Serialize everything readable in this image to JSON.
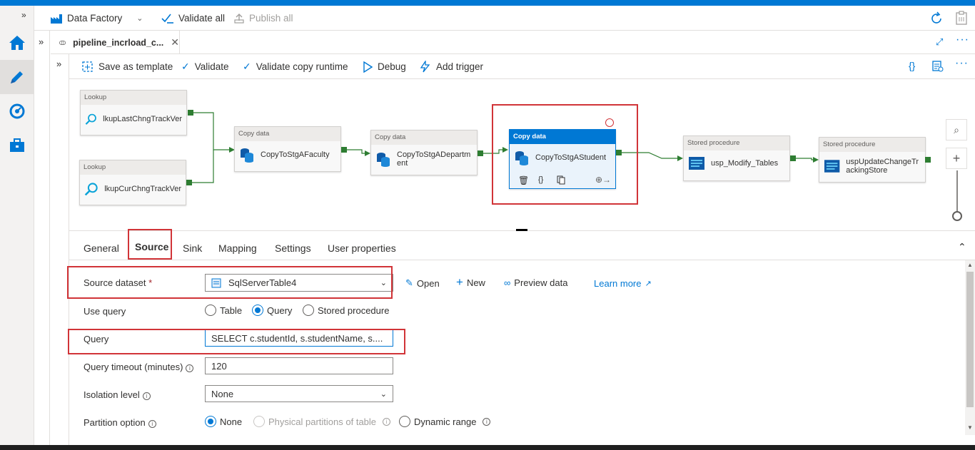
{
  "factory_bar": {
    "factory_name": "Data Factory",
    "validate_all": "Validate all",
    "publish_all": "Publish all"
  },
  "doc_tab": {
    "title": "pipeline_incrload_c..."
  },
  "command_bar": {
    "save_as_template": "Save as template",
    "validate": "Validate",
    "validate_copy_runtime": "Validate copy runtime",
    "debug": "Debug",
    "add_trigger": "Add trigger"
  },
  "activities": [
    {
      "type": "Lookup",
      "name": "lkupLastChngTrackVer"
    },
    {
      "type": "Lookup",
      "name": "lkupCurChngTrackVer"
    },
    {
      "type": "Copy data",
      "name": "CopyToStgAFaculty"
    },
    {
      "type": "Copy data",
      "name": "CopyToStgADepartment"
    },
    {
      "type": "Copy data",
      "name": "CopyToStgAStudent"
    },
    {
      "type": "Stored procedure",
      "name": "usp_Modify_Tables"
    },
    {
      "type": "Stored procedure",
      "name": "uspUpdateChangeTrackingStore"
    }
  ],
  "panel_tabs": [
    "General",
    "Source",
    "Sink",
    "Mapping",
    "Settings",
    "User properties"
  ],
  "form": {
    "source_dataset_label": "Source dataset",
    "required_mark": "*",
    "source_dataset_value": "SqlServerTable4",
    "open_label": "Open",
    "new_label": "New",
    "preview_label": "Preview data",
    "learn_more_label": "Learn more",
    "use_query_label": "Use query",
    "use_query_options": [
      "Table",
      "Query",
      "Stored procedure"
    ],
    "query_label": "Query",
    "query_value": "SELECT c.studentId, s.studentName, s....",
    "timeout_label": "Query timeout (minutes)",
    "timeout_value": "120",
    "isolation_label": "Isolation level",
    "isolation_value": "None",
    "partition_label": "Partition option",
    "partition_options": [
      "None",
      "Physical partitions of table",
      "Dynamic range"
    ]
  },
  "colors": {
    "accent": "#0078d4",
    "highlight": "#d13438",
    "port": "#2e7d32"
  }
}
